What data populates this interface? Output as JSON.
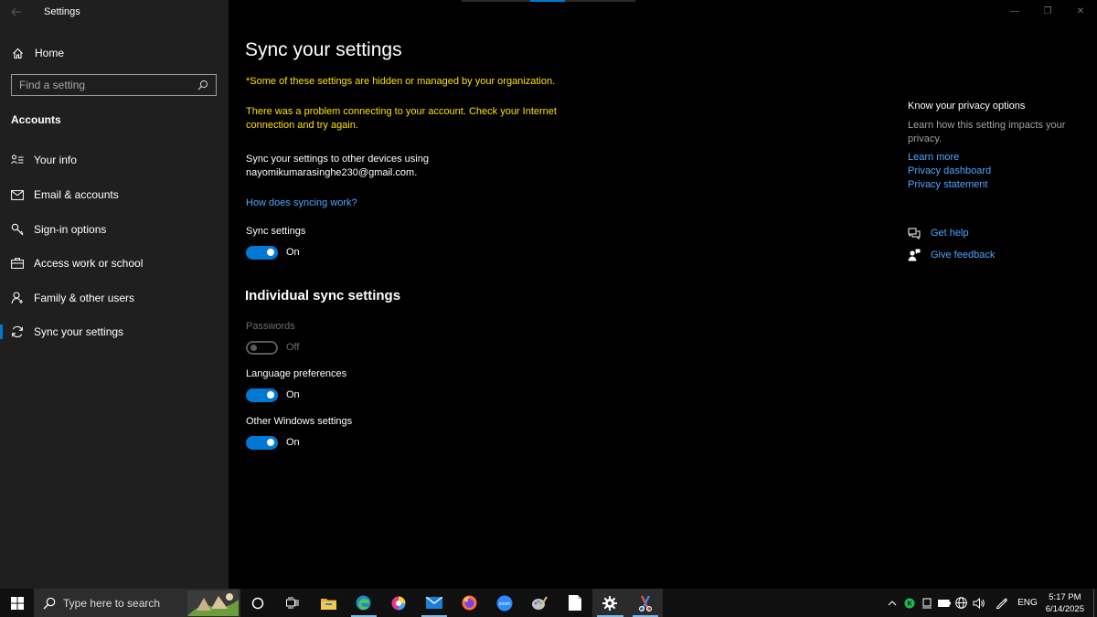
{
  "window": {
    "title": "Settings",
    "controls": {
      "minimize": "—",
      "restore": "❐",
      "close": "✕"
    }
  },
  "sidebar": {
    "home_label": "Home",
    "search_placeholder": "Find a setting",
    "section": "Accounts",
    "items": [
      {
        "label": "Your info",
        "icon": "person-list-icon",
        "active": false
      },
      {
        "label": "Email & accounts",
        "icon": "mail-icon",
        "active": false
      },
      {
        "label": "Sign-in options",
        "icon": "key-icon",
        "active": false
      },
      {
        "label": "Access work or school",
        "icon": "briefcase-icon",
        "active": false
      },
      {
        "label": "Family & other users",
        "icon": "person-add-icon",
        "active": false
      },
      {
        "label": "Sync your settings",
        "icon": "sync-icon",
        "active": true
      }
    ]
  },
  "main": {
    "title": "Sync your settings",
    "warning_managed": "*Some of these settings are hidden or managed by your organization.",
    "warning_connection": "There was a problem connecting to your account. Check your Internet connection and try again.",
    "description_line1": "Sync your settings to other devices using",
    "description_line2": "nayomikumarasinghe230@gmail.com.",
    "how_link": "How does syncing work?",
    "sync_settings": {
      "label": "Sync settings",
      "state": "On",
      "on": true
    },
    "individual_title": "Individual sync settings",
    "individual": [
      {
        "label": "Passwords",
        "state": "Off",
        "on": false,
        "disabled": true
      },
      {
        "label": "Language preferences",
        "state": "On",
        "on": true,
        "disabled": false
      },
      {
        "label": "Other Windows settings",
        "state": "On",
        "on": true,
        "disabled": false
      }
    ]
  },
  "aside": {
    "privacy_title": "Know your privacy options",
    "privacy_text": "Learn how this setting impacts your privacy.",
    "links": [
      "Learn more",
      "Privacy dashboard",
      "Privacy statement"
    ],
    "get_help": "Get help",
    "give_feedback": "Give feedback"
  },
  "taskbar": {
    "search_placeholder": "Type here to search",
    "apps": [
      {
        "name": "cortana-icon",
        "running": false,
        "active": false
      },
      {
        "name": "task-view-icon",
        "running": false,
        "active": false
      },
      {
        "name": "file-explorer-icon",
        "running": false,
        "active": false
      },
      {
        "name": "edge-icon",
        "running": true,
        "active": false
      },
      {
        "name": "color-app-icon",
        "running": false,
        "active": false
      },
      {
        "name": "mail-app-icon",
        "running": true,
        "active": false
      },
      {
        "name": "firefox-icon",
        "running": false,
        "active": false
      },
      {
        "name": "zoom-icon",
        "running": false,
        "active": false
      },
      {
        "name": "paint-icon",
        "running": false,
        "active": false
      },
      {
        "name": "notepad-icon",
        "running": false,
        "active": false
      },
      {
        "name": "settings-gear-icon",
        "running": true,
        "active": true
      },
      {
        "name": "snipping-icon",
        "running": true,
        "active": true
      }
    ],
    "zoom_label": "zoom",
    "language": "ENG",
    "time": "5:17 PM",
    "date": "6/14/2025"
  },
  "colors": {
    "accent": "#0078d4",
    "warning": "#ffe100",
    "link": "#4ea6ff",
    "sidebar_bg": "#1f1f1f"
  }
}
